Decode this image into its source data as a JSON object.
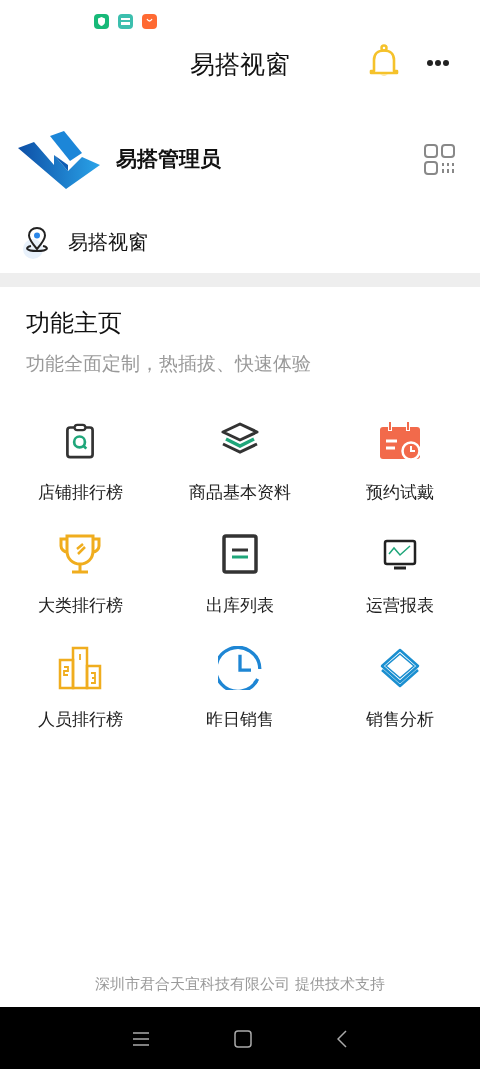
{
  "header": {
    "title": "易搭视窗"
  },
  "profile": {
    "name": "易搭管理员"
  },
  "location": {
    "name": "易搭视窗"
  },
  "section": {
    "title": "功能主页",
    "subtitle": "功能全面定制，热插拔、快速体验"
  },
  "features": [
    {
      "label": "店铺排行榜"
    },
    {
      "label": "商品基本资料"
    },
    {
      "label": "预约试戴"
    },
    {
      "label": "大类排行榜"
    },
    {
      "label": "出库列表"
    },
    {
      "label": "运营报表"
    },
    {
      "label": "人员排行榜"
    },
    {
      "label": "昨日销售"
    },
    {
      "label": "销售分析"
    }
  ],
  "footer": "深圳市君合天宜科技有限公司 提供技术支持"
}
